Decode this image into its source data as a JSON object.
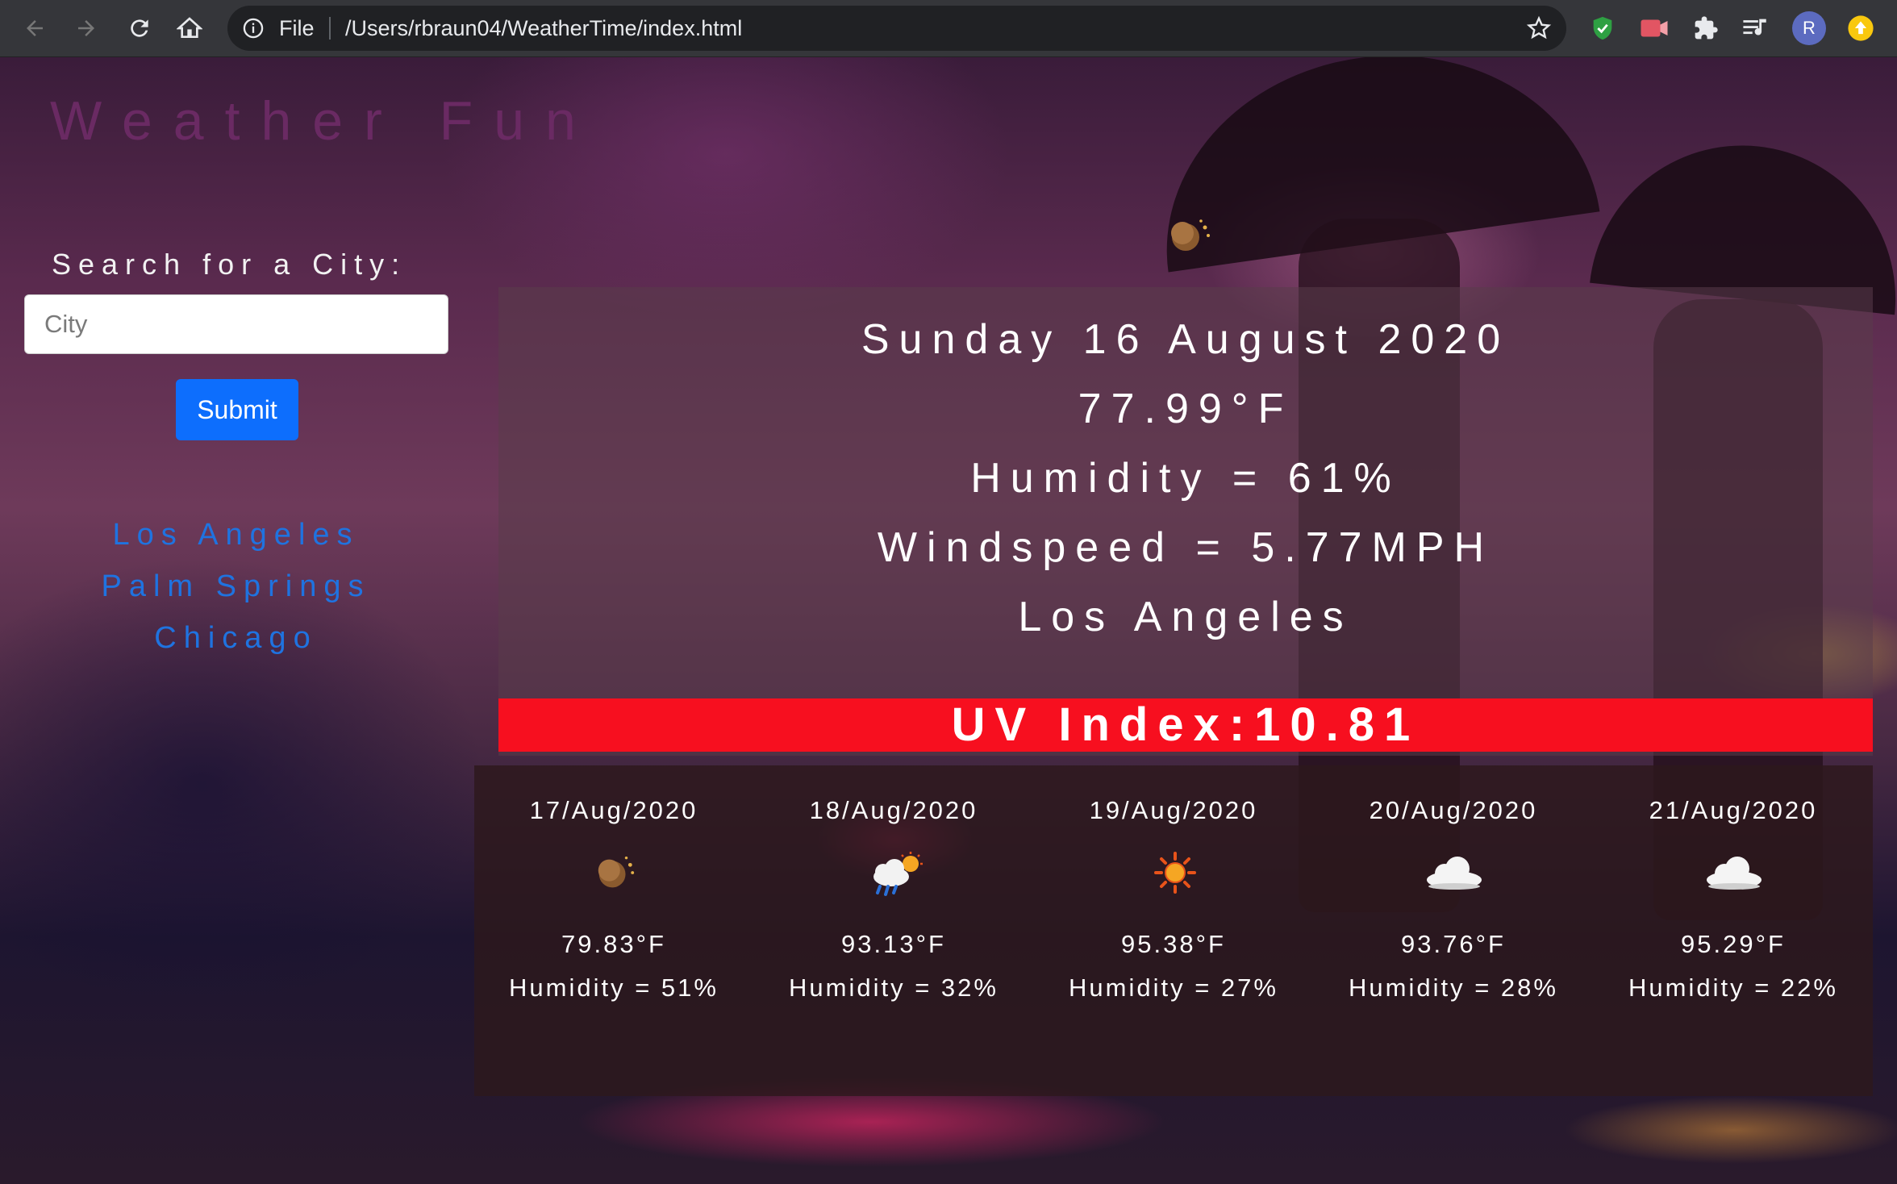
{
  "browser": {
    "omnibox_scheme": "File",
    "url": "/Users/rbraun04/WeatherTime/index.html",
    "profile_initial": "R",
    "icons": [
      "back-arrow-icon",
      "forward-arrow-icon",
      "reload-icon",
      "home-icon",
      "info-icon",
      "star-icon",
      "shield-extension-icon",
      "video-extension-icon",
      "puzzle-icon",
      "media-queue-icon",
      "profile-avatar",
      "update-indicator-icon"
    ]
  },
  "app": {
    "title": "Weather Fun",
    "title_color": "#6a2a63"
  },
  "search": {
    "label": "Search for a City:",
    "placeholder": "City",
    "value": "",
    "submit_label": "Submit"
  },
  "history": {
    "cities": [
      "Los Angeles",
      "Palm Springs",
      "Chicago"
    ],
    "link_color": "#1f73e0"
  },
  "current": {
    "date": "Sunday 16 August 2020",
    "temperature": "77.99°F",
    "humidity": "Humidity = 61%",
    "windspeed": "Windspeed = 5.77MPH",
    "city": "Los Angeles",
    "icon": "moon-clear-icon",
    "uv_index": "UV Index:10.81",
    "uv_color": "#f70f1f"
  },
  "forecast": [
    {
      "date": "17/Aug/2020",
      "temp": "79.83°F",
      "humidity": "Humidity = 51%",
      "icon": "moon-clear-icon"
    },
    {
      "date": "18/Aug/2020",
      "temp": "93.13°F",
      "humidity": "Humidity = 32%",
      "icon": "rain-sun-icon"
    },
    {
      "date": "19/Aug/2020",
      "temp": "95.38°F",
      "humidity": "Humidity = 27%",
      "icon": "sun-icon"
    },
    {
      "date": "20/Aug/2020",
      "temp": "93.76°F",
      "humidity": "Humidity = 28%",
      "icon": "cloud-icon"
    },
    {
      "date": "21/Aug/2020",
      "temp": "95.29°F",
      "humidity": "Humidity = 22%",
      "icon": "cloud-icon"
    }
  ]
}
